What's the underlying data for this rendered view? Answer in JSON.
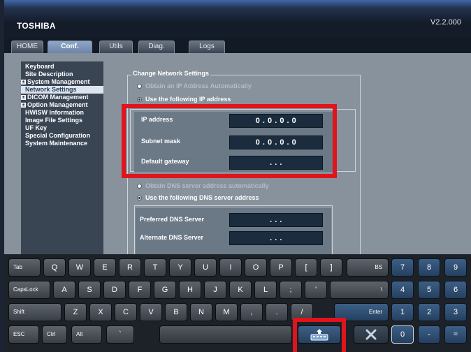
{
  "header": {
    "brand": "TOSHIBA",
    "version": "V2.2.000"
  },
  "tabs": [
    {
      "label": "HOME"
    },
    {
      "label": "Conf."
    },
    {
      "label": "Utils"
    },
    {
      "label": "Diag."
    },
    {
      "label": "Logs"
    }
  ],
  "active_tab": "Conf.",
  "sidebar": {
    "items": [
      {
        "label": "Keyboard"
      },
      {
        "label": "Site Description"
      },
      {
        "label": "System Management",
        "expander": "+"
      },
      {
        "label": "Network Settings",
        "selected": true
      },
      {
        "label": "DICOM Management",
        "expander": "+"
      },
      {
        "label": "Option Management",
        "expander": "+"
      },
      {
        "label": "HWISW Information"
      },
      {
        "label": "Image File Settings"
      },
      {
        "label": "UF Key"
      },
      {
        "label": "Special Configuration"
      },
      {
        "label": "System Maintenance"
      }
    ]
  },
  "network": {
    "group_title": "Change Network Settings",
    "ip_options": [
      {
        "label": "Obtain an IP Address Automatically",
        "checked": false
      },
      {
        "label": "Use the following IP address",
        "checked": true
      }
    ],
    "ip_fields": [
      {
        "label": "IP address",
        "value": "0 . 0 . 0 . 0"
      },
      {
        "label": "Subnet mask",
        "value": "0 . 0 . 0 . 0"
      },
      {
        "label": "Default gateway",
        "value": ".    .    ."
      }
    ],
    "dns_options": [
      {
        "label": "Obtain DNS server address automatically",
        "checked": false
      },
      {
        "label": "Use the following DNS server address",
        "checked": true
      }
    ],
    "dns_fields": [
      {
        "label": "Preferred DNS Server",
        "value": ".    .    ."
      },
      {
        "label": "Alternate DNS Server",
        "value": ".    .    ."
      }
    ]
  },
  "keyboard": {
    "row1": [
      "Tab",
      "Q",
      "W",
      "E",
      "R",
      "T",
      "Y",
      "U",
      "I",
      "O",
      "P",
      "[",
      "]",
      "BS"
    ],
    "row2": [
      "CapsLock",
      "A",
      "S",
      "D",
      "F",
      "G",
      "H",
      "J",
      "K",
      "L",
      ";",
      "'",
      "\\"
    ],
    "row3": [
      "Shift",
      "Z",
      "X",
      "C",
      "V",
      "B",
      "N",
      "M",
      ",",
      ".",
      "/",
      "Enter"
    ],
    "row4": [
      "ESC",
      "Ctrl",
      "Alt",
      "`"
    ],
    "numpad": [
      "7",
      "8",
      "9",
      "4",
      "5",
      "6",
      "1",
      "2",
      "3",
      "0",
      "-",
      "="
    ],
    "icons": {
      "hide_keyboard": "keyboard-hide-icon",
      "close": "close-x-icon"
    }
  },
  "colors": {
    "highlight": "#e0141c",
    "panel": "#87929c",
    "field": "#1a2c3e",
    "accent_key": "#24405f"
  }
}
